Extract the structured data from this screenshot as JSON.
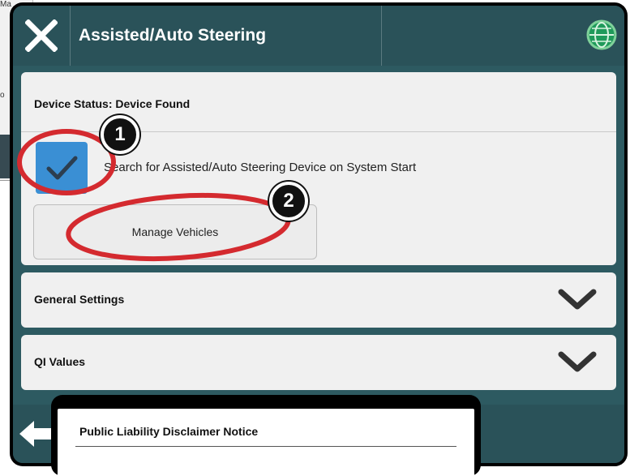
{
  "background_window": {
    "text_top": "Ma",
    "text_mid": "o"
  },
  "header": {
    "title": "Assisted/Auto Steering",
    "close_icon": "close-icon",
    "globe_icon": "globe-icon"
  },
  "device_status": {
    "label": "Device Status: Device Found"
  },
  "search_option": {
    "checked": true,
    "label": "Search for Assisted/Auto Steering Device on System Start"
  },
  "manage_vehicles": {
    "label": "Manage Vehicles"
  },
  "sections": [
    {
      "label": "General Settings",
      "icon": "chevron-down-icon"
    },
    {
      "label": "QI Values",
      "icon": "chevron-down-icon"
    }
  ],
  "annotations": [
    {
      "number": "1"
    },
    {
      "number": "2"
    }
  ],
  "popup": {
    "title": "Public Liability Disclaimer Notice"
  },
  "colors": {
    "titlebar": "#2a5259",
    "accent_blue": "#3a8fd4",
    "annotation_red": "#d42a2f",
    "card_bg": "#f0f0f0"
  }
}
